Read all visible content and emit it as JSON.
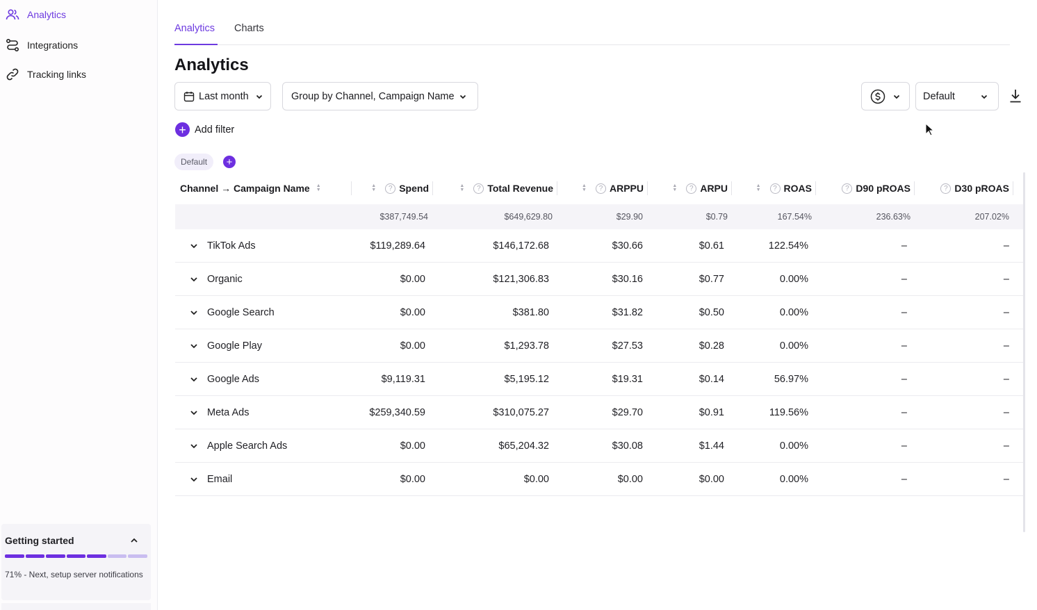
{
  "sidebar": {
    "items": [
      {
        "label": "Analytics",
        "icon": "users-icon",
        "active": true
      },
      {
        "label": "Integrations",
        "icon": "route-icon",
        "active": false
      },
      {
        "label": "Tracking links",
        "icon": "link-icon",
        "active": false
      }
    ],
    "getting_started": {
      "title": "Getting started",
      "progress_steps_total": 7,
      "progress_steps_done": 5,
      "status_text": "71% - Next, setup server notifications"
    }
  },
  "tabs": [
    {
      "label": "Analytics",
      "active": true
    },
    {
      "label": "Charts",
      "active": false
    }
  ],
  "page_title": "Analytics",
  "controls": {
    "date_range": "Last month",
    "group_by": "Group by Channel, Campaign Name",
    "currency_icon": "dollar-circle-icon",
    "view": "Default",
    "download_icon": "download-icon"
  },
  "add_filter_label": "Add filter",
  "preset_chip": "Default",
  "table": {
    "columns": [
      {
        "label": "Channel → Campaign Name"
      },
      {
        "label": "Spend"
      },
      {
        "label": "Total Revenue"
      },
      {
        "label": "ARPPU"
      },
      {
        "label": "ARPU"
      },
      {
        "label": "ROAS"
      },
      {
        "label": "D90 pROAS"
      },
      {
        "label": "D30 pROAS"
      }
    ],
    "totals": [
      "",
      "$387,749.54",
      "$649,629.80",
      "$29.90",
      "$0.79",
      "167.54%",
      "236.63%",
      "207.02%"
    ],
    "rows": [
      {
        "name": "TikTok Ads",
        "spend": "$119,289.64",
        "revenue": "$146,172.68",
        "arppu": "$30.66",
        "arpu": "$0.61",
        "roas": "122.54%",
        "d90": "–",
        "d30": "–"
      },
      {
        "name": "Organic",
        "spend": "$0.00",
        "revenue": "$121,306.83",
        "arppu": "$30.16",
        "arpu": "$0.77",
        "roas": "0.00%",
        "d90": "–",
        "d30": "–"
      },
      {
        "name": "Google Search",
        "spend": "$0.00",
        "revenue": "$381.80",
        "arppu": "$31.82",
        "arpu": "$0.50",
        "roas": "0.00%",
        "d90": "–",
        "d30": "–"
      },
      {
        "name": "Google Play",
        "spend": "$0.00",
        "revenue": "$1,293.78",
        "arppu": "$27.53",
        "arpu": "$0.28",
        "roas": "0.00%",
        "d90": "–",
        "d30": "–"
      },
      {
        "name": "Google Ads",
        "spend": "$9,119.31",
        "revenue": "$5,195.12",
        "arppu": "$19.31",
        "arpu": "$0.14",
        "roas": "56.97%",
        "d90": "–",
        "d30": "–"
      },
      {
        "name": "Meta Ads",
        "spend": "$259,340.59",
        "revenue": "$310,075.27",
        "arppu": "$29.70",
        "arpu": "$0.91",
        "roas": "119.56%",
        "d90": "–",
        "d30": "–"
      },
      {
        "name": "Apple Search Ads",
        "spend": "$0.00",
        "revenue": "$65,204.32",
        "arppu": "$30.08",
        "arpu": "$1.44",
        "roas": "0.00%",
        "d90": "–",
        "d30": "–"
      },
      {
        "name": "Email",
        "spend": "$0.00",
        "revenue": "$0.00",
        "arppu": "$0.00",
        "arpu": "$0.00",
        "roas": "0.00%",
        "d90": "–",
        "d30": "–"
      }
    ]
  },
  "colors": {
    "accent": "#6d2fe0",
    "accent_text": "#6d3ae0",
    "total_row_bg": "#f5f4f8"
  }
}
